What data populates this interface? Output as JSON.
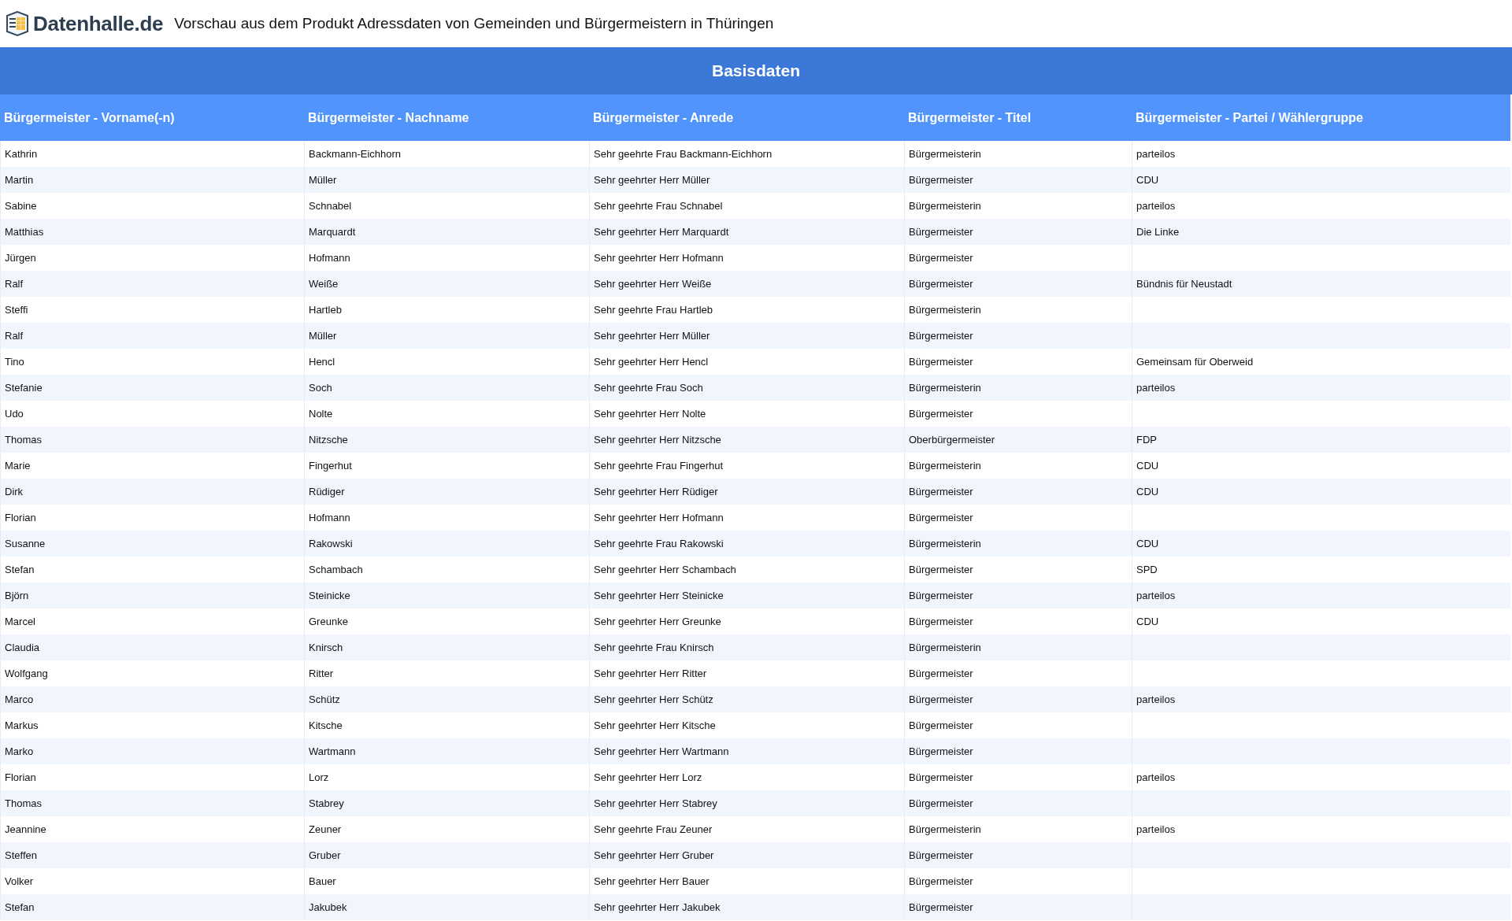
{
  "header": {
    "logo_text": "Datenhalle.de",
    "title": "Vorschau aus dem Produkt Adressdaten von Gemeinden und Bürgermeistern in Thüringen"
  },
  "section": {
    "title": "Basisdaten"
  },
  "table": {
    "columns": [
      "Bürgermeister - Vorname(-n)",
      "Bürgermeister - Nachname",
      "Bürgermeister - Anrede",
      "Bürgermeister - Titel",
      "Bürgermeister - Partei / Wählergruppe"
    ],
    "rows": [
      {
        "first_name": "Kathrin",
        "last_name": "Backmann-Eichhorn",
        "salutation": "Sehr geehrte Frau Backmann-Eichhorn",
        "title": "Bürgermeisterin",
        "party": "parteilos"
      },
      {
        "first_name": "Martin",
        "last_name": "Müller",
        "salutation": "Sehr geehrter Herr Müller",
        "title": "Bürgermeister",
        "party": "CDU"
      },
      {
        "first_name": "Sabine",
        "last_name": "Schnabel",
        "salutation": "Sehr geehrte Frau Schnabel",
        "title": "Bürgermeisterin",
        "party": "parteilos"
      },
      {
        "first_name": "Matthias",
        "last_name": "Marquardt",
        "salutation": "Sehr geehrter Herr Marquardt",
        "title": "Bürgermeister",
        "party": "Die Linke"
      },
      {
        "first_name": "Jürgen",
        "last_name": "Hofmann",
        "salutation": "Sehr geehrter Herr Hofmann",
        "title": "Bürgermeister"
      },
      {
        "first_name": "Ralf",
        "last_name": "Weiße",
        "salutation": "Sehr geehrter Herr Weiße",
        "title": "Bürgermeister",
        "party": "Bündnis für Neustadt"
      },
      {
        "first_name": "Steffi",
        "last_name": "Hartleb",
        "salutation": "Sehr geehrte Frau Hartleb",
        "title": "Bürgermeisterin"
      },
      {
        "first_name": "Ralf",
        "last_name": "Müller",
        "salutation": "Sehr geehrter Herr Müller",
        "title": "Bürgermeister"
      },
      {
        "first_name": "Tino",
        "last_name": "Hencl",
        "salutation": "Sehr geehrter Herr Hencl",
        "title": "Bürgermeister",
        "party": "Gemeinsam für Oberweid"
      },
      {
        "first_name": "Stefanie",
        "last_name": "Soch",
        "salutation": "Sehr geehrte Frau Soch",
        "title": "Bürgermeisterin",
        "party": "parteilos"
      },
      {
        "first_name": "Udo",
        "last_name": "Nolte",
        "salutation": "Sehr geehrter Herr Nolte",
        "title": "Bürgermeister"
      },
      {
        "first_name": "Thomas",
        "last_name": "Nitzsche",
        "salutation": "Sehr geehrter Herr Nitzsche",
        "title": "Oberbürgermeister",
        "party": "FDP"
      },
      {
        "first_name": "Marie",
        "last_name": "Fingerhut",
        "salutation": "Sehr geehrte Frau Fingerhut",
        "title": "Bürgermeisterin",
        "party": "CDU"
      },
      {
        "first_name": "Dirk",
        "last_name": "Rüdiger",
        "salutation": "Sehr geehrter Herr Rüdiger",
        "title": "Bürgermeister",
        "party": "CDU"
      },
      {
        "first_name": "Florian",
        "last_name": "Hofmann",
        "salutation": "Sehr geehrter Herr Hofmann",
        "title": "Bürgermeister"
      },
      {
        "first_name": "Susanne",
        "last_name": "Rakowski",
        "salutation": "Sehr geehrte Frau Rakowski",
        "title": "Bürgermeisterin",
        "party": "CDU"
      },
      {
        "first_name": "Stefan",
        "last_name": "Schambach",
        "salutation": "Sehr geehrter Herr Schambach",
        "title": "Bürgermeister",
        "party": "SPD"
      },
      {
        "first_name": "Björn",
        "last_name": "Steinicke",
        "salutation": "Sehr geehrter Herr Steinicke",
        "title": "Bürgermeister",
        "party": "parteilos"
      },
      {
        "first_name": "Marcel",
        "last_name": "Greunke",
        "salutation": "Sehr geehrter Herr Greunke",
        "title": "Bürgermeister",
        "party": "CDU"
      },
      {
        "first_name": "Claudia",
        "last_name": "Knirsch",
        "salutation": "Sehr geehrte Frau Knirsch",
        "title": "Bürgermeisterin"
      },
      {
        "first_name": "Wolfgang",
        "last_name": "Ritter",
        "salutation": "Sehr geehrter Herr Ritter",
        "title": "Bürgermeister"
      },
      {
        "first_name": "Marco",
        "last_name": "Schütz",
        "salutation": "Sehr geehrter Herr Schütz",
        "title": "Bürgermeister",
        "party": "parteilos"
      },
      {
        "first_name": "Markus",
        "last_name": "Kitsche",
        "salutation": "Sehr geehrter Herr Kitsche",
        "title": "Bürgermeister"
      },
      {
        "first_name": "Marko",
        "last_name": "Wartmann",
        "salutation": "Sehr geehrter Herr Wartmann",
        "title": "Bürgermeister"
      },
      {
        "first_name": "Florian",
        "last_name": "Lorz",
        "salutation": "Sehr geehrter Herr Lorz",
        "title": "Bürgermeister",
        "party": "parteilos"
      },
      {
        "first_name": "Thomas",
        "last_name": "Stabrey",
        "salutation": "Sehr geehrter Herr Stabrey",
        "title": "Bürgermeister"
      },
      {
        "first_name": "Jeannine",
        "last_name": "Zeuner",
        "salutation": "Sehr geehrte Frau Zeuner",
        "title": "Bürgermeisterin",
        "party": "parteilos"
      },
      {
        "first_name": "Steffen",
        "last_name": "Gruber",
        "salutation": "Sehr geehrter Herr Gruber",
        "title": "Bürgermeister"
      },
      {
        "first_name": "Volker",
        "last_name": "Bauer",
        "salutation": "Sehr geehrter Herr Bauer",
        "title": "Bürgermeister"
      },
      {
        "first_name": "Stefan",
        "last_name": "Jakubek",
        "salutation": "Sehr geehrter Herr Jakubek",
        "title": "Bürgermeister"
      }
    ]
  }
}
